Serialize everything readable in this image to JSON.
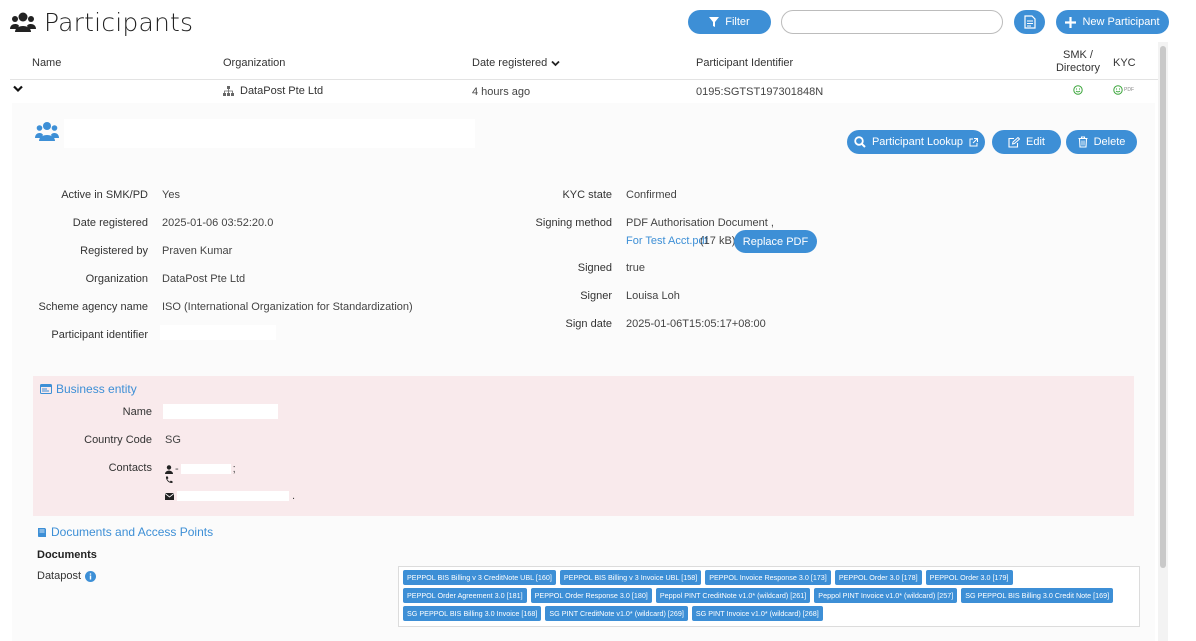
{
  "header": {
    "title": "Participants",
    "filter_label": "Filter",
    "search_placeholder": "",
    "new_label": "New Participant"
  },
  "table": {
    "columns": {
      "name": "Name",
      "organization": "Organization",
      "date_registered": "Date registered",
      "participant_identifier": "Participant Identifier",
      "smk_directory_line1": "SMK /",
      "smk_directory_line2": "Directory",
      "kyc": "KYC"
    },
    "row": {
      "organization": "DataPost Pte Ltd",
      "date": "4 hours ago",
      "participant_identifier": "0195:SGTST197301848N",
      "kyc_pdf": "PDF"
    }
  },
  "detail": {
    "buttons": {
      "lookup": "Participant Lookup",
      "edit": "Edit",
      "delete": "Delete"
    },
    "left": {
      "active_label": "Active in SMK/PD",
      "active_value": "Yes",
      "date_label": "Date registered",
      "date_value": "2025-01-06 03:52:20.0",
      "registered_by_label": "Registered by",
      "registered_by_value": "Praven Kumar",
      "org_label": "Organization",
      "org_value": "DataPost Pte Ltd",
      "scheme_label": "Scheme agency name",
      "scheme_value": "ISO (International Organization for Standardization)",
      "pid_label": "Participant identifier"
    },
    "right": {
      "kyc_state_label": "KYC state",
      "kyc_state_value": "Confirmed",
      "signing_method_label": "Signing method",
      "signing_method_value": "PDF Authorisation Document ,",
      "pdf_link": "For Test Acct.pdf",
      "pdf_size": "(17 kB)",
      "replace_pdf": "Replace PDF",
      "signed_label": "Signed",
      "signed_value": "true",
      "signer_label": "Signer",
      "signer_value": "Louisa Loh",
      "sign_date_label": "Sign date",
      "sign_date_value": "2025-01-06T15:05:17+08:00"
    },
    "business": {
      "title": "Business entity",
      "name_label": "Name",
      "country_label": "Country Code",
      "country_value": "SG",
      "contacts_label": "Contacts",
      "contact_name_dash": "-",
      "contact_name_tail": ";",
      "contact_email_tail": "."
    },
    "documents": {
      "title": "Documents and Access Points",
      "subtitle": "Documents",
      "access_point": "Datapost",
      "tags": [
        "PEPPOL BIS Billing v 3 CreditNote UBL [160]",
        "PEPPOL BIS Billing v 3 Invoice UBL [158]",
        "PEPPOL Invoice Response 3.0 [173]",
        "PEPPOL Order 3.0 [178]",
        "PEPPOL Order 3.0 [179]",
        "PEPPOL Order Agreement 3.0 [181]",
        "PEPPOL Order Response 3.0 [180]",
        "Peppol PINT CreditNote v1.0* (wildcard) [261]",
        "Peppol PINT Invoice v1.0* (wildcard) [257]",
        "SG PEPPOL BIS Billing 3.0 Credit Note [169]",
        "SG PEPPOL BIS Billing 3.0 Invoice [168]",
        "SG PINT CreditNote v1.0* (wildcard) [269]",
        "SG PINT Invoice v1.0* (wildcard) [268]"
      ]
    }
  },
  "colors": {
    "accent": "#3d8fd6",
    "business_bg": "#f9eaec",
    "smk_ok": "#3aa53a"
  }
}
